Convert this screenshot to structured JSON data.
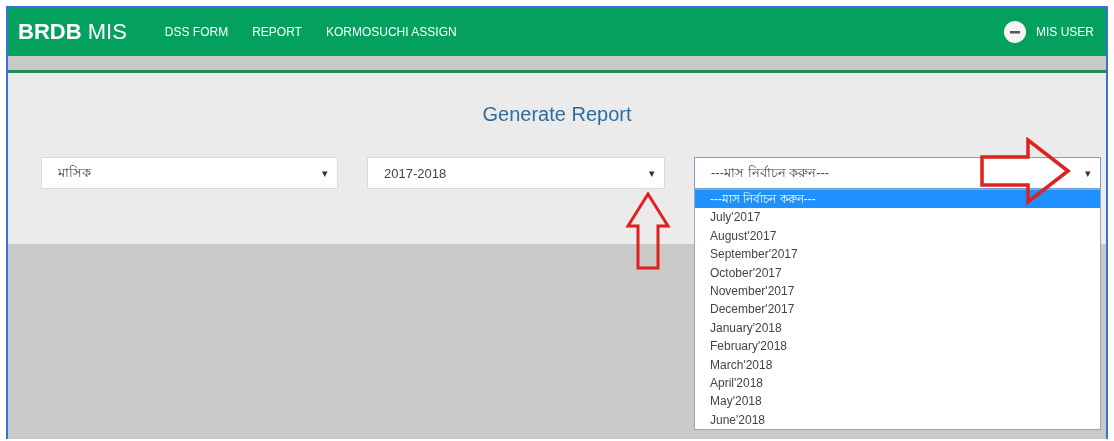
{
  "navbar": {
    "brand_bold": "BRDB",
    "brand_light": "MIS",
    "menu": [
      {
        "label": "DSS FORM"
      },
      {
        "label": "REPORT"
      },
      {
        "label": "KORMOSUCHI ASSIGN"
      }
    ],
    "user": "MIS USER"
  },
  "page_title": "Generate Report",
  "selects": [
    {
      "value": "মাসিক",
      "caret": "▾",
      "open": false
    },
    {
      "value": "2017-2018",
      "caret": "▾",
      "open": false
    },
    {
      "value": "---মাস নির্বাচন করুন---",
      "caret": "▾",
      "open": true
    }
  ],
  "month_options": [
    {
      "label": "---মাস নির্বাচন করুন---",
      "selected": true
    },
    {
      "label": "July'2017",
      "selected": false
    },
    {
      "label": "August'2017",
      "selected": false
    },
    {
      "label": "September'2017",
      "selected": false
    },
    {
      "label": "October'2017",
      "selected": false
    },
    {
      "label": "November'2017",
      "selected": false
    },
    {
      "label": "December'2017",
      "selected": false
    },
    {
      "label": "January'2018",
      "selected": false
    },
    {
      "label": "February'2018",
      "selected": false
    },
    {
      "label": "March'2018",
      "selected": false
    },
    {
      "label": "April'2018",
      "selected": false
    },
    {
      "label": "May'2018",
      "selected": false
    },
    {
      "label": "June'2018",
      "selected": false
    }
  ],
  "annotation_arrows": [
    {
      "kind": "up"
    },
    {
      "kind": "right"
    }
  ]
}
